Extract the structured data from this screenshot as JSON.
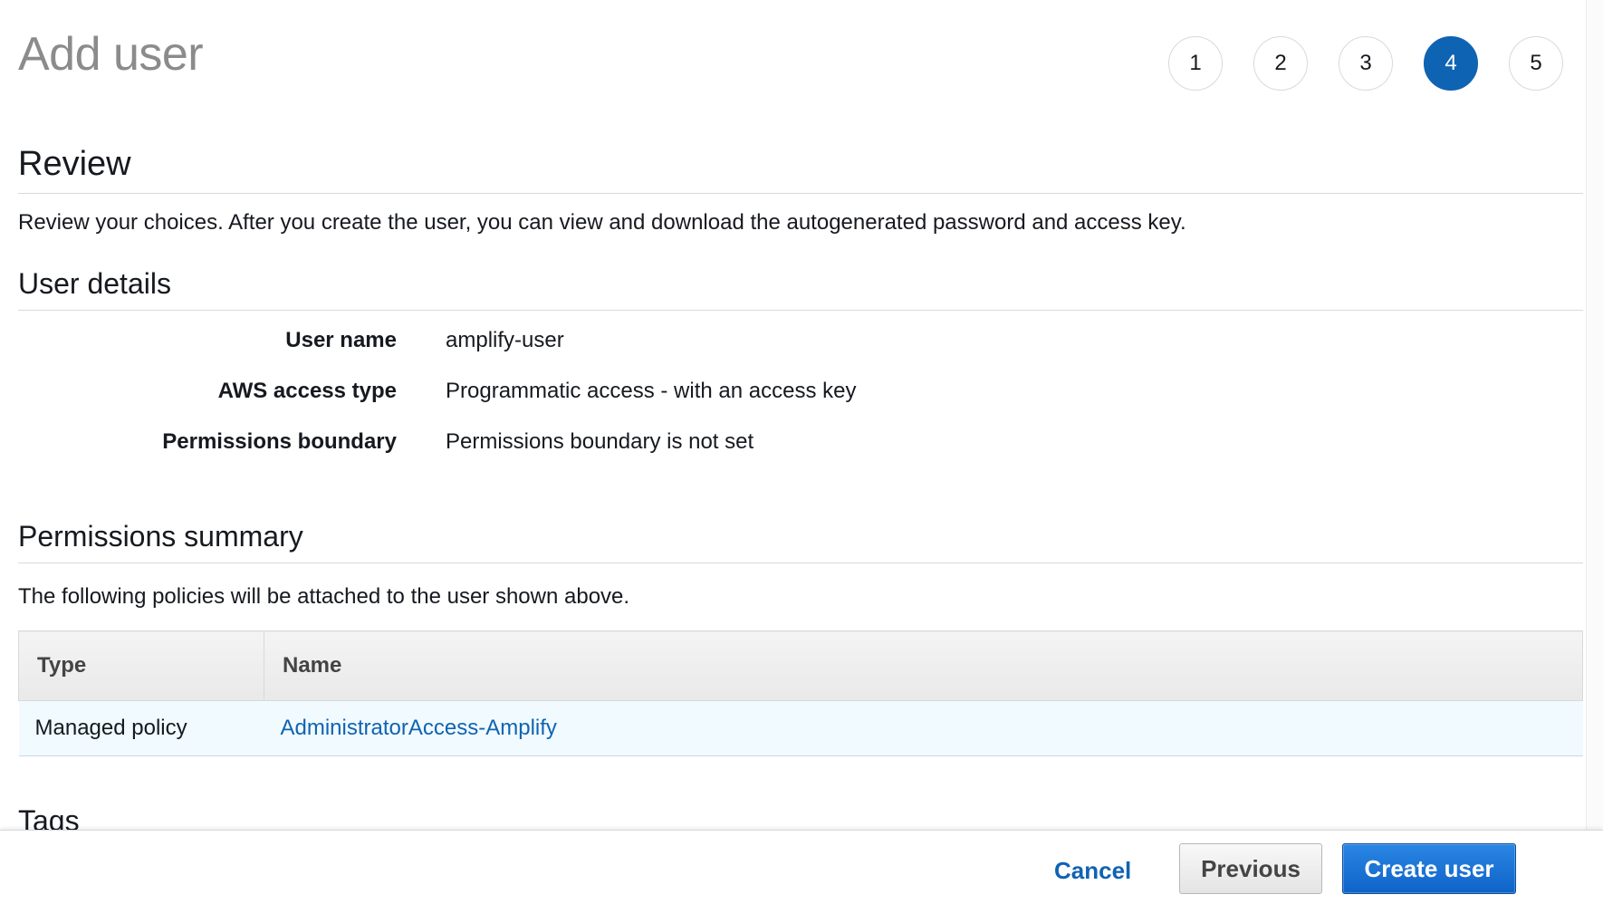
{
  "header": {
    "title": "Add user"
  },
  "stepper": {
    "steps": [
      "1",
      "2",
      "3",
      "4",
      "5"
    ],
    "active_step": 4
  },
  "review": {
    "heading": "Review",
    "description": "Review your choices. After you create the user, you can view and download the autogenerated password and access key."
  },
  "user_details": {
    "heading": "User details",
    "rows": [
      {
        "label": "User name",
        "value": "amplify-user"
      },
      {
        "label": "AWS access type",
        "value": "Programmatic access - with an access key"
      },
      {
        "label": "Permissions boundary",
        "value": "Permissions boundary is not set"
      }
    ]
  },
  "permissions_summary": {
    "heading": "Permissions summary",
    "description": "The following policies will be attached to the user shown above.",
    "columns": [
      "Type",
      "Name"
    ],
    "rows": [
      {
        "type": "Managed policy",
        "name": "AdministratorAccess-Amplify"
      }
    ]
  },
  "tags": {
    "heading": "Tags"
  },
  "footer": {
    "cancel_label": "Cancel",
    "previous_label": "Previous",
    "create_label": "Create user"
  },
  "colors": {
    "accent": "#0f63b3",
    "primary_button": "#1a73d9",
    "table_row_highlight": "#f1faff"
  }
}
